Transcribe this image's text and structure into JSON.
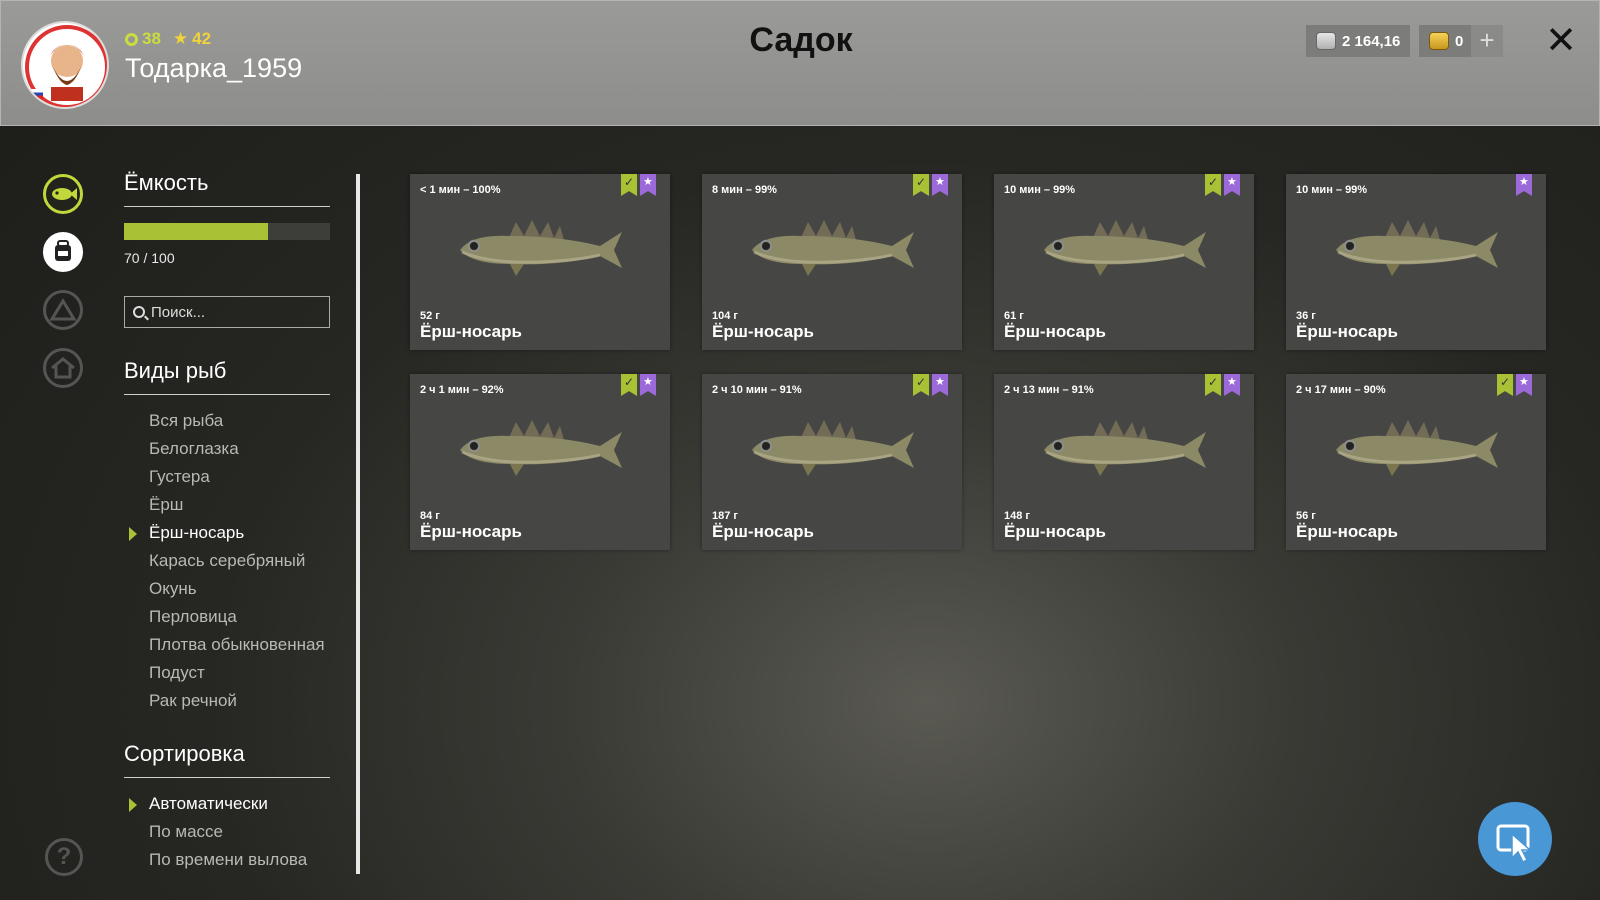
{
  "header": {
    "title": "Садок",
    "player": {
      "level": "38",
      "rank": "42",
      "username": "Тодарка_1959"
    },
    "silver": "2 164,16",
    "gold": "0"
  },
  "capacity": {
    "title": "Ёмкость",
    "fill_fraction": 0.7,
    "text": "70 / 100"
  },
  "search": {
    "placeholder": "Поиск..."
  },
  "species": {
    "title": "Виды рыб",
    "items": [
      "Вся рыба",
      "Белоглазка",
      "Густера",
      "Ёрш",
      "Ёрш-носарь",
      "Карась серебряный",
      "Окунь",
      "Перловица",
      "Плотва обыкновенная",
      "Подуст",
      "Рак речной"
    ],
    "selected_index": 4
  },
  "sorting": {
    "title": "Сортировка",
    "items": [
      "Автоматически",
      "По массе",
      "По времени вылова"
    ],
    "selected_index": 0
  },
  "fish_cards": [
    {
      "time": "< 1 мин – 100%",
      "weight": "52 г",
      "name": "Ёрш-носарь",
      "marks": [
        "green",
        "purple"
      ]
    },
    {
      "time": "8 мин – 99%",
      "weight": "104 г",
      "name": "Ёрш-носарь",
      "marks": [
        "green",
        "purple"
      ]
    },
    {
      "time": "10 мин – 99%",
      "weight": "61 г",
      "name": "Ёрш-носарь",
      "marks": [
        "green",
        "purple"
      ]
    },
    {
      "time": "10 мин – 99%",
      "weight": "36 г",
      "name": "Ёрш-носарь",
      "marks": [
        "purple"
      ]
    },
    {
      "time": "2 ч 1 мин – 92%",
      "weight": "84 г",
      "name": "Ёрш-носарь",
      "marks": [
        "green",
        "purple"
      ]
    },
    {
      "time": "2 ч 10 мин – 91%",
      "weight": "187 г",
      "name": "Ёрш-носарь",
      "marks": [
        "green",
        "purple"
      ]
    },
    {
      "time": "2 ч 13 мин – 91%",
      "weight": "148 г",
      "name": "Ёрш-носарь",
      "marks": [
        "green",
        "purple"
      ]
    },
    {
      "time": "2 ч 17 мин – 90%",
      "weight": "56 г",
      "name": "Ёрш-носарь",
      "marks": [
        "green",
        "purple"
      ]
    }
  ],
  "colors": {
    "accent_green": "#a9c134",
    "accent_purple": "#9b6ad8",
    "action_blue": "#4a97d6"
  }
}
